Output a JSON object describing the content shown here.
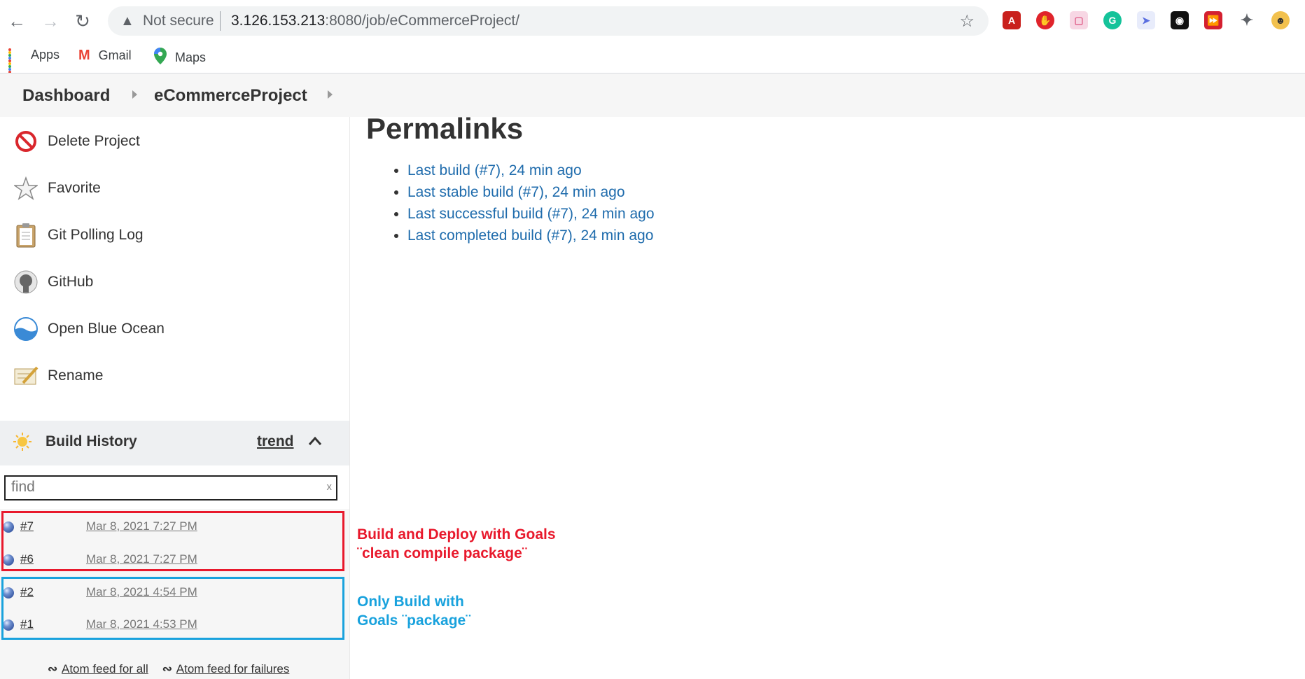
{
  "browser": {
    "security_label": "Not secure",
    "url_host": "3.126.153.213",
    "url_rest": ":8080/job/eCommerceProject/",
    "bookmarks": [
      {
        "label": "Apps",
        "icon": "apps-grid-icon"
      },
      {
        "label": "Gmail",
        "icon": "gmail-icon"
      },
      {
        "label": "Maps",
        "icon": "maps-pin-icon"
      }
    ]
  },
  "breadcrumb": {
    "items": [
      "Dashboard",
      "eCommerceProject"
    ]
  },
  "sidebar": {
    "tasks": [
      {
        "label": "Delete Project",
        "icon": "delete-icon"
      },
      {
        "label": "Favorite",
        "icon": "star-icon"
      },
      {
        "label": "Git Polling Log",
        "icon": "clipboard-icon"
      },
      {
        "label": "GitHub",
        "icon": "github-icon"
      },
      {
        "label": "Open Blue Ocean",
        "icon": "blue-ocean-icon"
      },
      {
        "label": "Rename",
        "icon": "rename-icon"
      }
    ]
  },
  "build_history": {
    "title": "Build History",
    "trend_label": "trend",
    "find_placeholder": "find",
    "find_value": "",
    "clear_label": "x",
    "builds": [
      {
        "number": "#7",
        "date": "Mar 8, 2021 7:27 PM"
      },
      {
        "number": "#6",
        "date": "Mar 8, 2021 7:27 PM"
      },
      {
        "number": "#2",
        "date": "Mar 8, 2021 4:54 PM"
      },
      {
        "number": "#1",
        "date": "Mar 8, 2021 4:53 PM"
      }
    ],
    "feed_all": "Atom feed for all",
    "feed_failures": "Atom feed for failures"
  },
  "main": {
    "title": "Permalinks",
    "links": [
      "Last build (#7), 24 min ago",
      "Last stable build (#7), 24 min ago",
      "Last successful build (#7), 24 min ago",
      "Last completed build (#7), 24 min ago"
    ]
  },
  "annotations": {
    "red": "Build and Deploy with Goals\n¨clean compile package¨",
    "blue": "Only Build with\nGoals ¨package¨",
    "red_color": "#e8192c",
    "blue_color": "#19a2dd"
  }
}
